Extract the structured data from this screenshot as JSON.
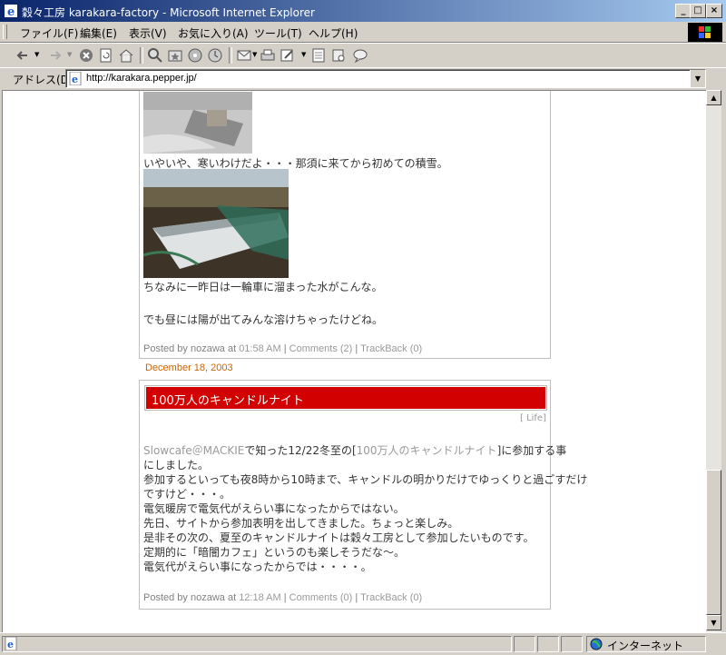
{
  "window": {
    "title": "穀々工房  karakara-factory - Microsoft Internet Explorer",
    "min_label": "_",
    "max_label": "□",
    "close_label": "×"
  },
  "menu": [
    "ファイル(F)",
    "編集(E)",
    "表示(V)",
    "お気に入り(A)",
    "ツール(T)",
    "ヘルプ(H)"
  ],
  "address": {
    "label": "アドレス(D)",
    "url": "http://karakara.pepper.jp/"
  },
  "post1": {
    "line1": "いやいや、寒いわけだよ・・・那須に来てから初めての積雪。",
    "line2": "ちなみに一昨日は一輪車に溜まった水がこんな。",
    "line3": "でも昼には陽が出てみんな溶けちゃったけどね。",
    "footer_prefix": "Posted by nozawa at",
    "time": "01:58 AM",
    "comments": "Comments (2)",
    "trackback": "TrackBack (0)"
  },
  "date_heading": "December 18, 2003",
  "post2": {
    "title": "100万人のキャンドルナイト",
    "category": "[ Life]",
    "link1": "Slowcafe＠MACKIE",
    "text1a": "で知った12/22冬至の[",
    "link2": "100万人のキャンドルナイト",
    "text1b": "]に参加する事",
    "line2": "にしました。",
    "line3": "参加するといっても夜8時から10時まで、キャンドルの明かりだけでゆっくりと過ごすだけ",
    "line4": "ですけど・・・。",
    "line5": "電気暖房で電気代がえらい事になったからではない。",
    "line6": "先日、サイトから参加表明を出してきました。ちょっと楽しみ。",
    "line7": "是非その次の、夏至のキャンドルナイトは穀々工房として参加したいものです。",
    "line8": "定期的に「暗闇カフェ」というのも楽しそうだな〜。",
    "line9": "電気代がえらい事になったからでは・・・・。",
    "footer_prefix": "Posted by nozawa at",
    "time": "12:18 AM",
    "comments": "Comments (0)",
    "trackback": "TrackBack (0)"
  },
  "status": {
    "zone": "インターネット"
  },
  "colors": {
    "titlebar_start": "#0a246a",
    "titlebar_end": "#a6caf0",
    "post_title_bg": "#d20000",
    "date_color": "#cc6600"
  }
}
